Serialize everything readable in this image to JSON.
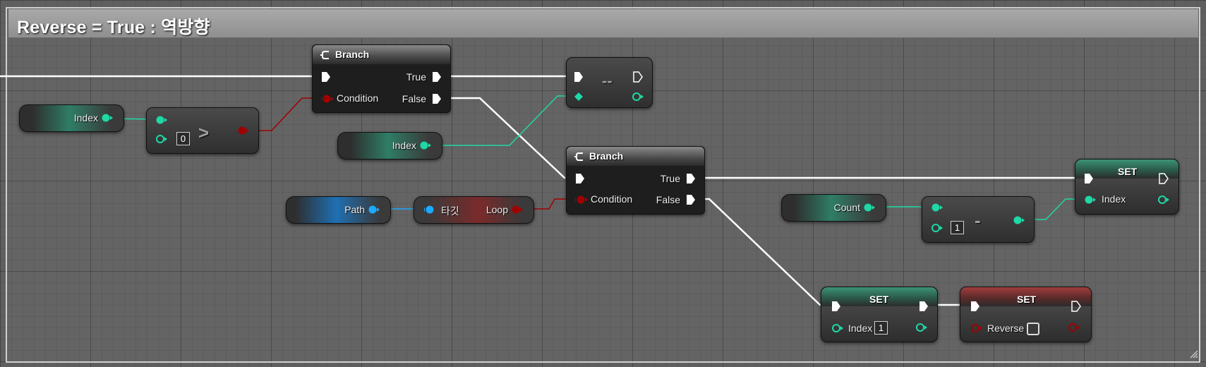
{
  "comment": {
    "title": "Reverse = True : 역방향"
  },
  "nodes": {
    "index_getter_1": {
      "label": "Index"
    },
    "greater_node": {
      "operator": ">",
      "literal": "0"
    },
    "branch_1": {
      "title": "Branch",
      "condition": "Condition",
      "true_label": "True",
      "false_label": "False"
    },
    "decrement_node": {
      "operator": "--"
    },
    "index_getter_2": {
      "label": "Index"
    },
    "path_getter": {
      "label": "Path"
    },
    "loop_getter": {
      "target": "타깃",
      "output": "Loop"
    },
    "branch_2": {
      "title": "Branch",
      "condition": "Condition",
      "true_label": "True",
      "false_label": "False"
    },
    "count_getter": {
      "label": "Count"
    },
    "subtract_node": {
      "operator": "-",
      "literal": "1"
    },
    "set_index_1": {
      "title": "SET",
      "label": "Index"
    },
    "set_index_2": {
      "title": "SET",
      "label": "Index",
      "value": "1"
    },
    "set_reverse": {
      "title": "SET",
      "label": "Reverse",
      "checked": false
    }
  },
  "colors": {
    "exec_wire": "#ffffff",
    "int_pin": "#1fd8a5",
    "bool_pin": "#a10000",
    "object_pin": "#1da9ff"
  }
}
